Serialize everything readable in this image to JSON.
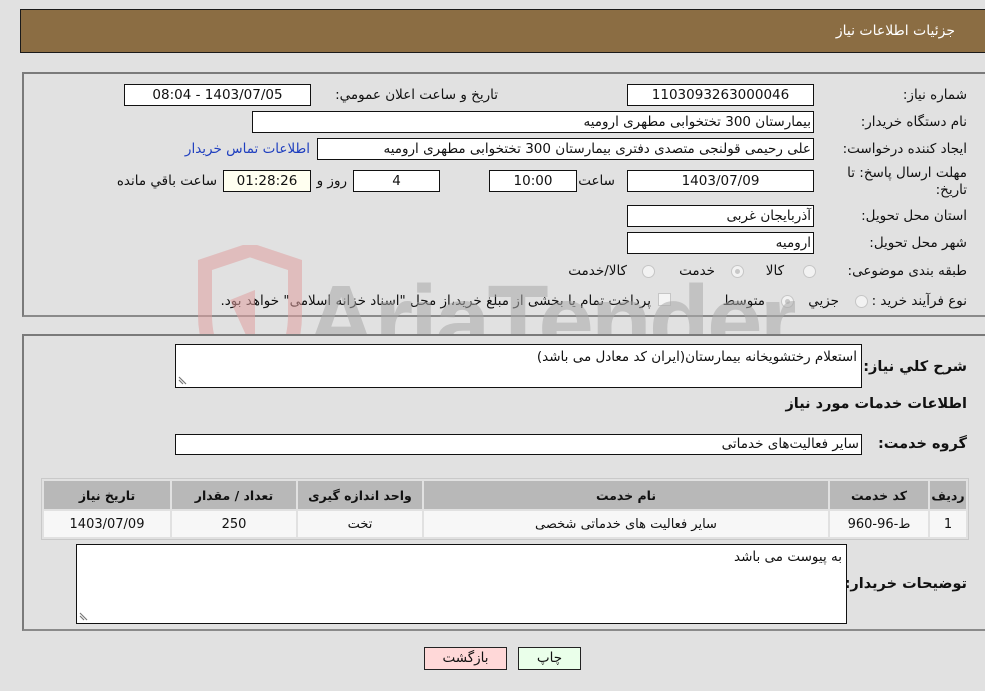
{
  "header": {
    "title": "جزئیات اطلاعات نیاز"
  },
  "form": {
    "need_number_label": "شماره نیاز:",
    "need_number": "1103093263000046",
    "announce_label": "تاریخ و ساعت اعلان عمومي:",
    "announce_value": "1403/07/05 - 08:04",
    "buyer_org_label": "نام دستگاه خریدار:",
    "buyer_org": "بیمارستان 300 تختخوابی مطهری  ارومیه",
    "creator_label": "ایجاد کننده درخواست:",
    "creator": "علی رحیمی قولنجی متصدی دفتری بیمارستان 300 تختخوابی مطهری  ارومیه",
    "contact_link": "اطلاعات تماس خریدار",
    "deadline_label": "مهلت ارسال پاسخ: تا تاریخ:",
    "deadline_date": "1403/07/09",
    "time_label": "ساعت",
    "deadline_time": "10:00",
    "days_value": "4",
    "days_label": "روز و",
    "remaining_time": "01:28:26",
    "remaining_label": "ساعت باقي مانده",
    "province_label": "استان محل تحویل:",
    "province": "آذربایجان غربی",
    "city_label": "شهر محل تحویل:",
    "city": "ارومیه",
    "category_label": "طبقه بندی موضوعی:",
    "category_options": [
      {
        "label": "کالا",
        "checked": false
      },
      {
        "label": "خدمت",
        "checked": true
      },
      {
        "label": "کالا/خدمت",
        "checked": false
      }
    ],
    "process_label": "نوع فرآیند خرید :",
    "process_options": [
      {
        "label": "جزيي",
        "checked": false
      },
      {
        "label": "متوسط",
        "checked": true
      }
    ],
    "treasury_note": "پرداخت تمام یا بخشی از مبلغ خرید،از محل \"اسناد خزانه اسلامی\" خواهد بود."
  },
  "details": {
    "description_label": "شرح کلي نياز:",
    "description": "استعلام رختشویخانه بیمارستان(ایران کد معادل می باشد)",
    "services_heading": "اطلاعات خدمات مورد نیاز",
    "service_group_label": "گروه خدمت:",
    "service_group": "سایر فعالیت‌های خدماتی",
    "table": {
      "columns": [
        "ردیف",
        "کد خدمت",
        "نام خدمت",
        "واحد اندازه گیری",
        "تعداد / مقدار",
        "تاریخ نیاز"
      ],
      "rows": [
        [
          "1",
          "ط-96-960",
          "سایر فعالیت های خدماتی شخصی",
          "تخت",
          "250",
          "1403/07/09"
        ]
      ]
    },
    "buyer_notes_label": "توضیحات خریدار:",
    "buyer_notes": "به پیوست می باشد"
  },
  "buttons": {
    "print": "چاپ",
    "back": "بازگشت"
  },
  "watermark": {
    "text": "AriaTender.neT"
  },
  "colors": {
    "header_bg": "#8b6d43",
    "link": "#1f3fbf",
    "print_bg": "#eaffea",
    "back_bg": "#ffd8d8"
  }
}
